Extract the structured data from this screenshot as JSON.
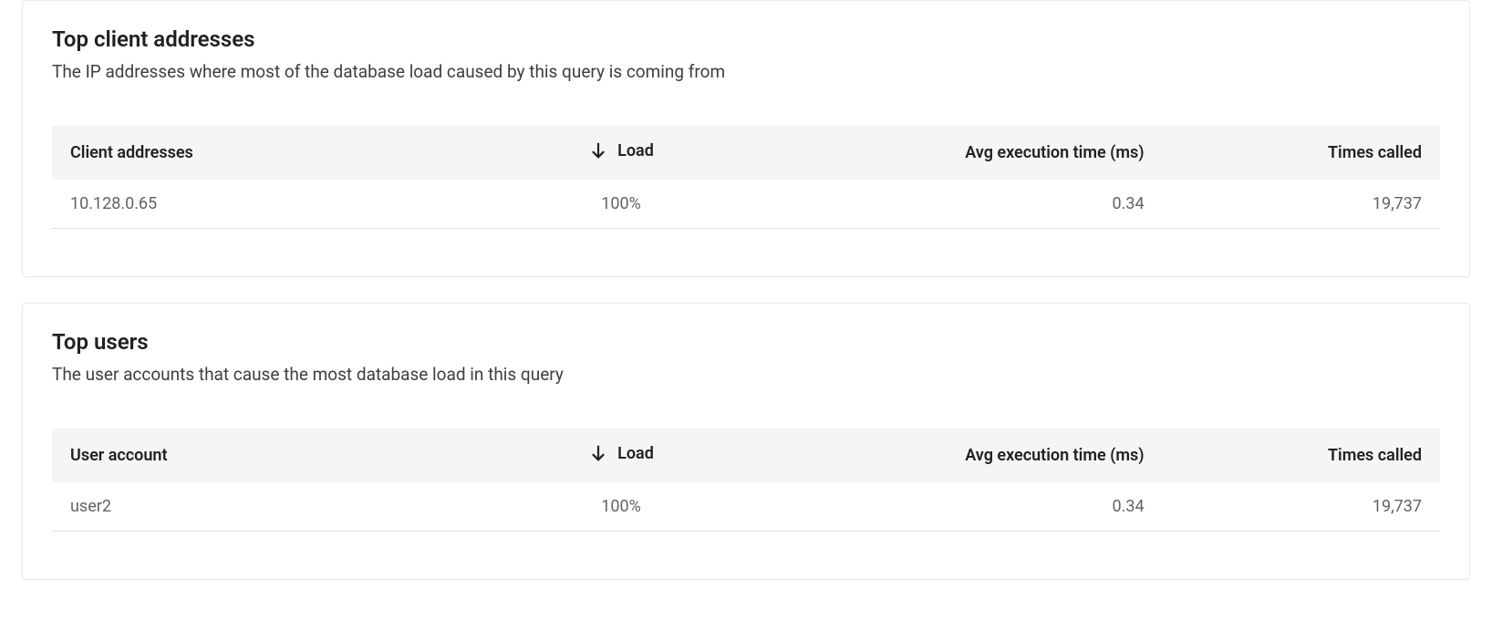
{
  "top_clients": {
    "title": "Top client addresses",
    "subtitle": "The IP addresses where most of the database load caused by this query is coming from",
    "headers": {
      "col1": "Client addresses",
      "load": "Load",
      "avg": "Avg execution time (ms)",
      "times": "Times called"
    },
    "rows": [
      {
        "col1": "10.128.0.65",
        "load": "100%",
        "avg": "0.34",
        "times": "19,737"
      }
    ]
  },
  "top_users": {
    "title": "Top users",
    "subtitle": "The user accounts that cause the most database load in this query",
    "headers": {
      "col1": "User account",
      "load": "Load",
      "avg": "Avg execution time (ms)",
      "times": "Times called"
    },
    "rows": [
      {
        "col1": "user2",
        "load": "100%",
        "avg": "0.34",
        "times": "19,737"
      }
    ]
  }
}
